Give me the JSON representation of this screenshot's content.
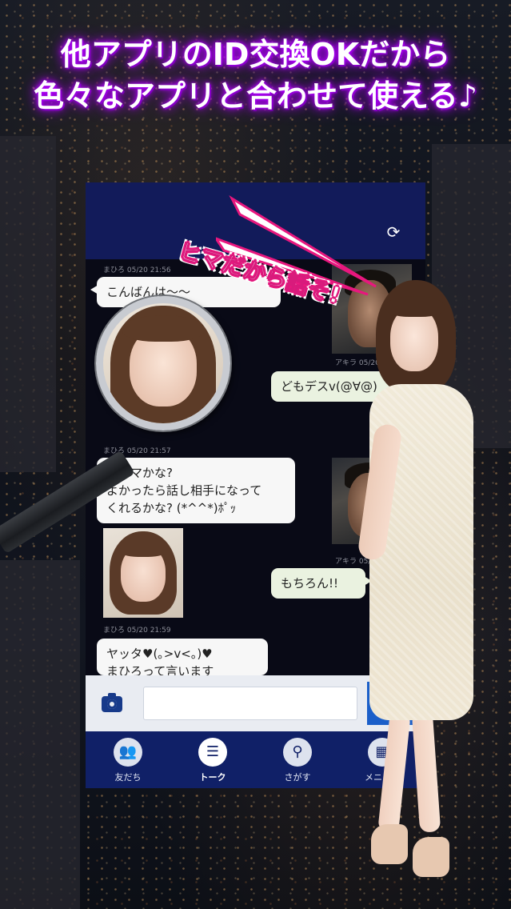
{
  "headline": {
    "line1": "他アプリのID交換OKだから",
    "line2": "色々なアプリと合わせて使える♪"
  },
  "sticker": {
    "text": "ヒマだから話そ!"
  },
  "messages": [
    {
      "sender": "まひろ",
      "time": "05/20 21:56",
      "text": "こんばんは〜〜",
      "side": "left"
    },
    {
      "sender": "アキラ",
      "time": "05/20 21:57",
      "text": "どもデスv(@∀@)",
      "side": "right"
    },
    {
      "sender": "まひろ",
      "time": "05/20 21:57",
      "text": "今ヒマかな?\nよかったら話し相手になって\nくれるかな? (*^^*)ﾎﾟｯ",
      "side": "left"
    },
    {
      "sender": "アキラ",
      "time": "05/20",
      "text": "もちろん!!",
      "side": "right"
    },
    {
      "sender": "まひろ",
      "time": "05/20 21:59",
      "text": "ヤッタ♥(｡>v<｡)♥\nまひろって言います",
      "side": "left"
    }
  ],
  "tabs": [
    {
      "label": "友だち",
      "icon": "friends-icon",
      "glyph": "👥",
      "active": false
    },
    {
      "label": "トーク",
      "icon": "talk-icon",
      "glyph": "☰",
      "active": true
    },
    {
      "label": "さがす",
      "icon": "search-icon",
      "glyph": "⚲",
      "active": false
    },
    {
      "label": "メニュー",
      "icon": "menu-icon",
      "glyph": "▦",
      "active": false
    }
  ],
  "input": {
    "placeholder": ""
  },
  "colors": {
    "header": "#121b5a",
    "tab_bar": "#102067",
    "send_button": "#1b5fc9",
    "headline_glow": "#b400ff",
    "sticker_pink": "#e8177e"
  }
}
